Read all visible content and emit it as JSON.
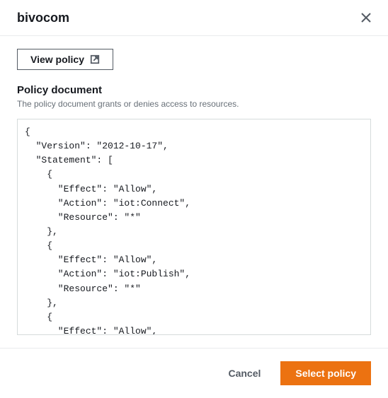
{
  "header": {
    "title": "bivocom"
  },
  "buttons": {
    "view_policy": "View policy",
    "cancel": "Cancel",
    "select_policy": "Select policy"
  },
  "section": {
    "title": "Policy document",
    "description": "The policy document grants or denies access to resources."
  },
  "policy_document": "{\n  \"Version\": \"2012-10-17\",\n  \"Statement\": [\n    {\n      \"Effect\": \"Allow\",\n      \"Action\": \"iot:Connect\",\n      \"Resource\": \"*\"\n    },\n    {\n      \"Effect\": \"Allow\",\n      \"Action\": \"iot:Publish\",\n      \"Resource\": \"*\"\n    },\n    {\n      \"Effect\": \"Allow\",\n      \"Action\": \"iot:Receive\",\n"
}
